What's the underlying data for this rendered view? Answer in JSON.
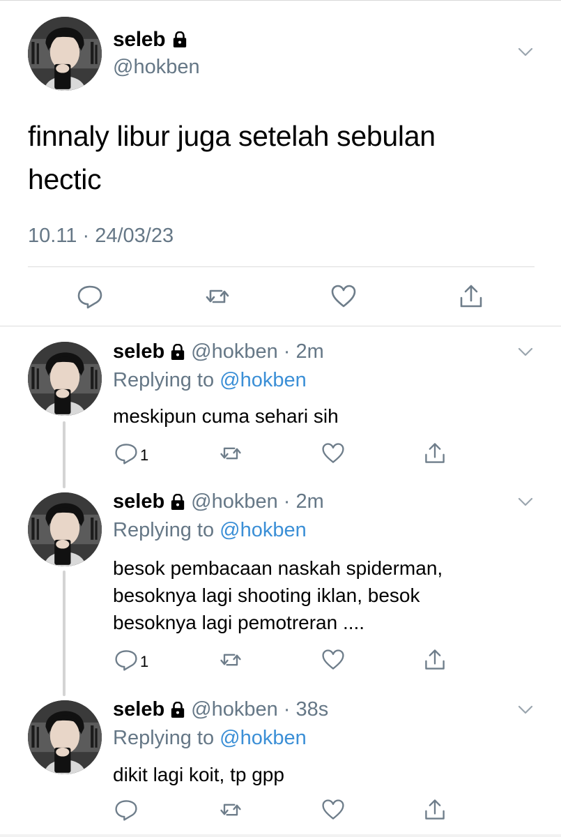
{
  "main_tweet": {
    "name": "seleb",
    "handle": "@hokben",
    "text_line1": "finnaly libur juga setelah sebulan",
    "text_line2": "hectic",
    "timestamp": "10.11 · 24/03/23",
    "locked": true
  },
  "replies": [
    {
      "name": "seleb",
      "handle": "@hokben · 2m",
      "replying_prefix": "Replying to ",
      "replying_to": "@hokben",
      "text_lines": [
        "meskipun cuma sehari sih"
      ],
      "reply_count": "1"
    },
    {
      "name": "seleb",
      "handle": "@hokben · 2m",
      "replying_prefix": "Replying to ",
      "replying_to": "@hokben",
      "text_lines": [
        "besok pembacaan naskah spiderman,",
        "besoknya lagi shooting iklan, besok",
        "besoknya lagi pemotreran ...."
      ],
      "reply_count": "1"
    },
    {
      "name": "seleb",
      "handle": "@hokben · 38s",
      "replying_prefix": "Replying to ",
      "replying_to": "@hokben",
      "text_lines": [
        "dikit lagi koit, tp gpp"
      ],
      "reply_count": ""
    }
  ],
  "icons": {
    "reply": "speech-bubble-icon",
    "retweet": "retweet-icon",
    "like": "heart-icon",
    "share": "share-upload-icon",
    "more": "chevron-down-icon",
    "lock": "padlock-icon"
  },
  "colors": {
    "text": "#000000",
    "secondary": "#657786",
    "mention": "#3b8fd6",
    "divider": "#dcdcdc",
    "thread_line": "#d4d4d4"
  }
}
